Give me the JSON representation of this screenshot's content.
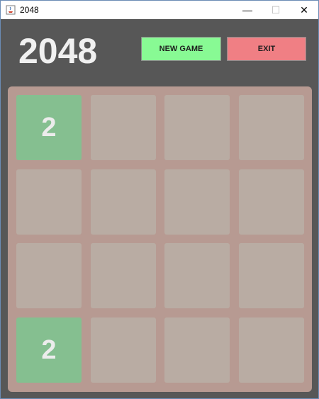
{
  "window": {
    "title": "2048",
    "controls": {
      "minimize": "—",
      "maximize": "☐",
      "close": "✕"
    }
  },
  "header": {
    "logo": "2048",
    "new_game_label": "NEW GAME",
    "exit_label": "EXIT"
  },
  "colors": {
    "background": "#575757",
    "board": "#b79a92",
    "empty_tile": "#b9aca3",
    "tile_2": "#85bf90",
    "new_game_button": "#88fa94",
    "exit_button": "#f07f84"
  },
  "board": {
    "rows": [
      [
        "2",
        "",
        "",
        ""
      ],
      [
        "",
        "",
        "",
        ""
      ],
      [
        "",
        "",
        "",
        ""
      ],
      [
        "2",
        "",
        "",
        ""
      ]
    ]
  }
}
